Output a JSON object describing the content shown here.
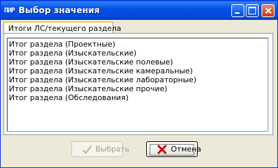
{
  "window": {
    "app_icon_text": "ПИР",
    "title": "Выбор значения"
  },
  "tabs": [
    {
      "label": "Итоги ЛС/текущего раздела"
    }
  ],
  "list": {
    "items": [
      "Итог раздела (Проектные)",
      "Итог раздела (Изыскательские)",
      "Итог раздела (Изыскательские полевые)",
      "Итог раздела (Изыскательские камеральные)",
      "Итог раздела (Изыскательские лабораторные)",
      "Итог раздела (Изыскательские прочие)",
      "Итог раздела (Обследования)"
    ]
  },
  "buttons": {
    "select_label": "Выбрать",
    "cancel_label": "Отмена"
  },
  "icons": {
    "select": "checkmark-icon",
    "cancel": "red-x-icon"
  },
  "colors": {
    "titlebar": "#0552e6",
    "tab_highlight": "#ffc83c",
    "cancel_icon": "#d00000"
  }
}
